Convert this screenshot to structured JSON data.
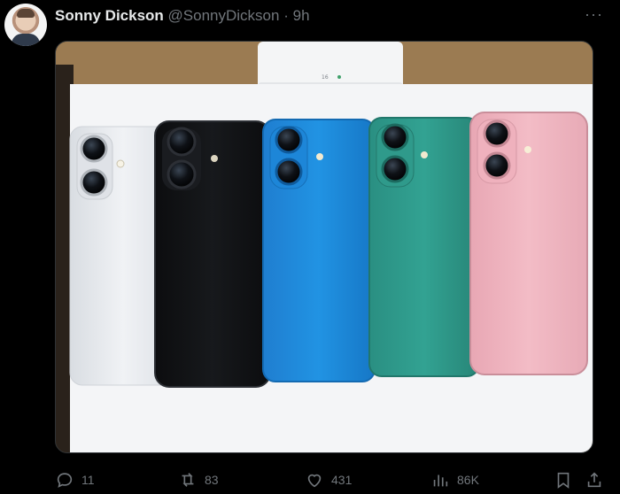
{
  "tweet": {
    "author_name": "Sonny Dickson",
    "author_handle": "@SonnyDickson",
    "separator": "·",
    "time": "9h"
  },
  "media": {
    "description_colors": [
      "#e6e8ec",
      "#111214",
      "#1a86d6",
      "#2e9a8c",
      "#f0b6c1"
    ],
    "box_label": "16"
  },
  "actions": {
    "replies": "11",
    "retweets": "83",
    "likes": "431",
    "views": "86K"
  },
  "icons": {
    "more": "more-icon",
    "reply": "reply-icon",
    "retweet": "retweet-icon",
    "like": "heart-icon",
    "views": "views-icon",
    "bookmark": "bookmark-icon",
    "share": "share-icon"
  }
}
